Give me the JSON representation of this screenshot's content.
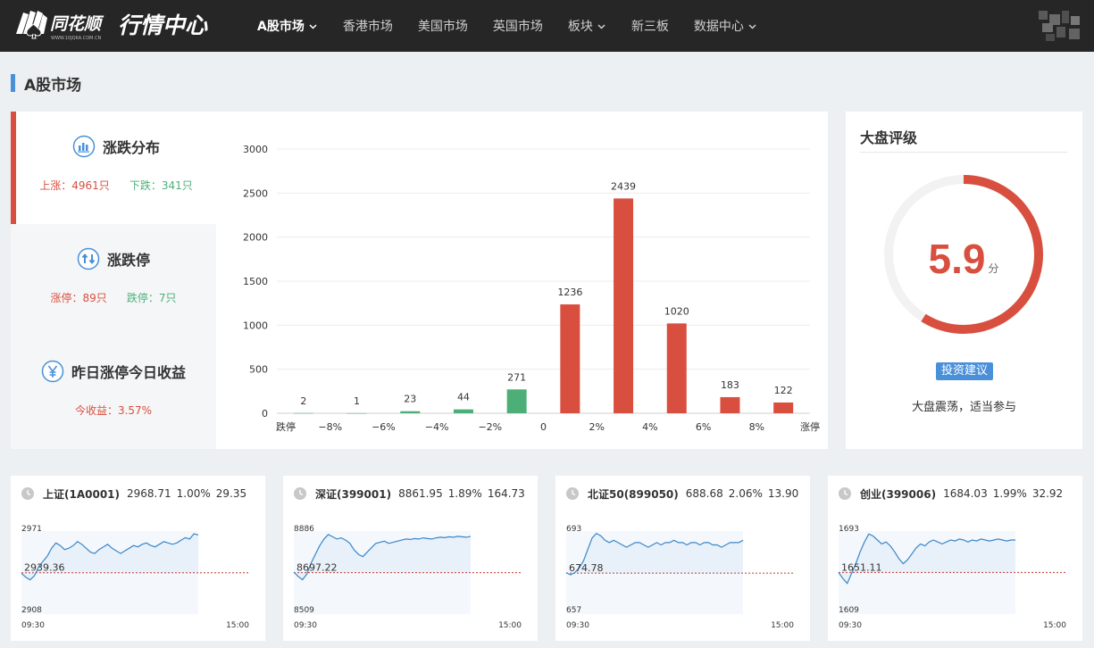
{
  "header": {
    "brand": "同花顺",
    "brand_sub": "WWW.10JQKA.COM.CN",
    "title": "行情中心",
    "nav": [
      {
        "label": "A股市场",
        "active": true,
        "dropdown": true
      },
      {
        "label": "香港市场",
        "active": false,
        "dropdown": false
      },
      {
        "label": "美国市场",
        "active": false,
        "dropdown": false
      },
      {
        "label": "英国市场",
        "active": false,
        "dropdown": false
      },
      {
        "label": "板块",
        "active": false,
        "dropdown": true
      },
      {
        "label": "新三板",
        "active": false,
        "dropdown": false
      },
      {
        "label": "数据中心",
        "active": false,
        "dropdown": true
      }
    ]
  },
  "section": {
    "title": "A股市场"
  },
  "tabs": [
    {
      "label": "涨跌分布",
      "icon": "bar-chart-icon",
      "active": true,
      "stats": [
        {
          "text": "上涨：4961只",
          "color": "red"
        },
        {
          "text": "下跌：341只",
          "color": "green"
        }
      ]
    },
    {
      "label": "涨跌停",
      "icon": "up-down-arrows-icon",
      "active": false,
      "stats": [
        {
          "text": "涨停：89只",
          "color": "red"
        },
        {
          "text": "跌停：7只",
          "color": "green"
        }
      ]
    },
    {
      "label": "昨日涨停今日收益",
      "icon": "yen-icon",
      "active": false,
      "stats": [
        {
          "text": "今收益：3.57%",
          "color": "red"
        }
      ]
    }
  ],
  "chart_data": {
    "type": "bar",
    "categories": [
      "跌停",
      "−8%",
      "−6%",
      "−4%",
      "−2%",
      "0",
      "2%",
      "4%",
      "6%",
      "8%",
      "涨停"
    ],
    "values": [
      2,
      1,
      23,
      44,
      271,
      1236,
      2439,
      1020,
      183,
      122
    ],
    "bar_colors": [
      "#4caf78",
      "#4caf78",
      "#4caf78",
      "#4caf78",
      "#4caf78",
      "#d94f3f",
      "#d94f3f",
      "#d94f3f",
      "#d94f3f",
      "#d94f3f"
    ],
    "yticks": [
      0,
      500,
      1000,
      1500,
      2000,
      2500,
      3000
    ],
    "ylim": [
      0,
      3000
    ],
    "title": "",
    "xlabel": "",
    "ylabel": ""
  },
  "rating": {
    "title": "大盘评级",
    "score": "5.9",
    "score_value": 5.9,
    "score_max": 10,
    "unit": "分",
    "advice_label": "投资建议",
    "advice_text": "大盘震荡，适当参与",
    "color": "#d94f3f"
  },
  "indices": [
    {
      "name": "上证(1A0001)",
      "price": "2968.71",
      "pct": "1.00%",
      "change": "29.35",
      "high": "2971",
      "low": "2908",
      "prev_close": "2939.36",
      "start_time": "09:30",
      "end_time": "15:00",
      "series": [
        2939,
        2936,
        2934,
        2937,
        2944,
        2948,
        2952,
        2958,
        2962,
        2960,
        2957,
        2958,
        2960,
        2963,
        2961,
        2958,
        2955,
        2954,
        2957,
        2959,
        2961,
        2958,
        2956,
        2954,
        2956,
        2958,
        2960,
        2959,
        2961,
        2962,
        2960,
        2959,
        2961,
        2963,
        2962,
        2961,
        2962,
        2964,
        2966,
        2965,
        2969,
        2968
      ]
    },
    {
      "name": "深证(399001)",
      "price": "8861.95",
      "pct": "1.89%",
      "change": "164.73",
      "high": "8886",
      "low": "8509",
      "prev_close": "8697.22",
      "start_time": "09:30",
      "end_time": "15:00",
      "series": [
        8700,
        8680,
        8665,
        8690,
        8740,
        8780,
        8820,
        8850,
        8870,
        8860,
        8850,
        8855,
        8845,
        8830,
        8800,
        8780,
        8770,
        8790,
        8810,
        8830,
        8835,
        8840,
        8830,
        8835,
        8840,
        8845,
        8850,
        8848,
        8852,
        8850,
        8855,
        8852,
        8850,
        8855,
        8858,
        8856,
        8860,
        8858,
        8862,
        8860,
        8858,
        8862
      ]
    },
    {
      "name": "北证50(899050)",
      "price": "688.68",
      "pct": "2.06%",
      "change": "13.90",
      "high": "693",
      "low": "657",
      "prev_close": "674.78",
      "start_time": "09:30",
      "end_time": "15:00",
      "series": [
        675,
        674,
        675,
        677,
        680,
        685,
        690,
        692,
        691,
        689,
        688,
        689,
        688,
        687,
        686,
        687,
        688,
        688,
        687,
        686,
        687,
        688,
        687,
        688,
        688,
        689,
        688,
        688,
        687,
        688,
        688,
        687,
        688,
        688,
        687,
        687,
        686,
        687,
        688,
        688,
        688,
        689
      ]
    },
    {
      "name": "创业(399006)",
      "price": "1684.03",
      "pct": "1.99%",
      "change": "32.92",
      "high": "1693",
      "low": "1609",
      "prev_close": "1651.11",
      "start_time": "09:30",
      "end_time": "15:00",
      "series": [
        1651,
        1645,
        1640,
        1650,
        1660,
        1672,
        1682,
        1690,
        1688,
        1684,
        1680,
        1682,
        1678,
        1672,
        1665,
        1660,
        1664,
        1670,
        1676,
        1680,
        1678,
        1682,
        1684,
        1682,
        1680,
        1682,
        1684,
        1683,
        1685,
        1684,
        1682,
        1684,
        1683,
        1685,
        1684,
        1683,
        1684,
        1685,
        1684,
        1683,
        1684,
        1684
      ]
    }
  ]
}
